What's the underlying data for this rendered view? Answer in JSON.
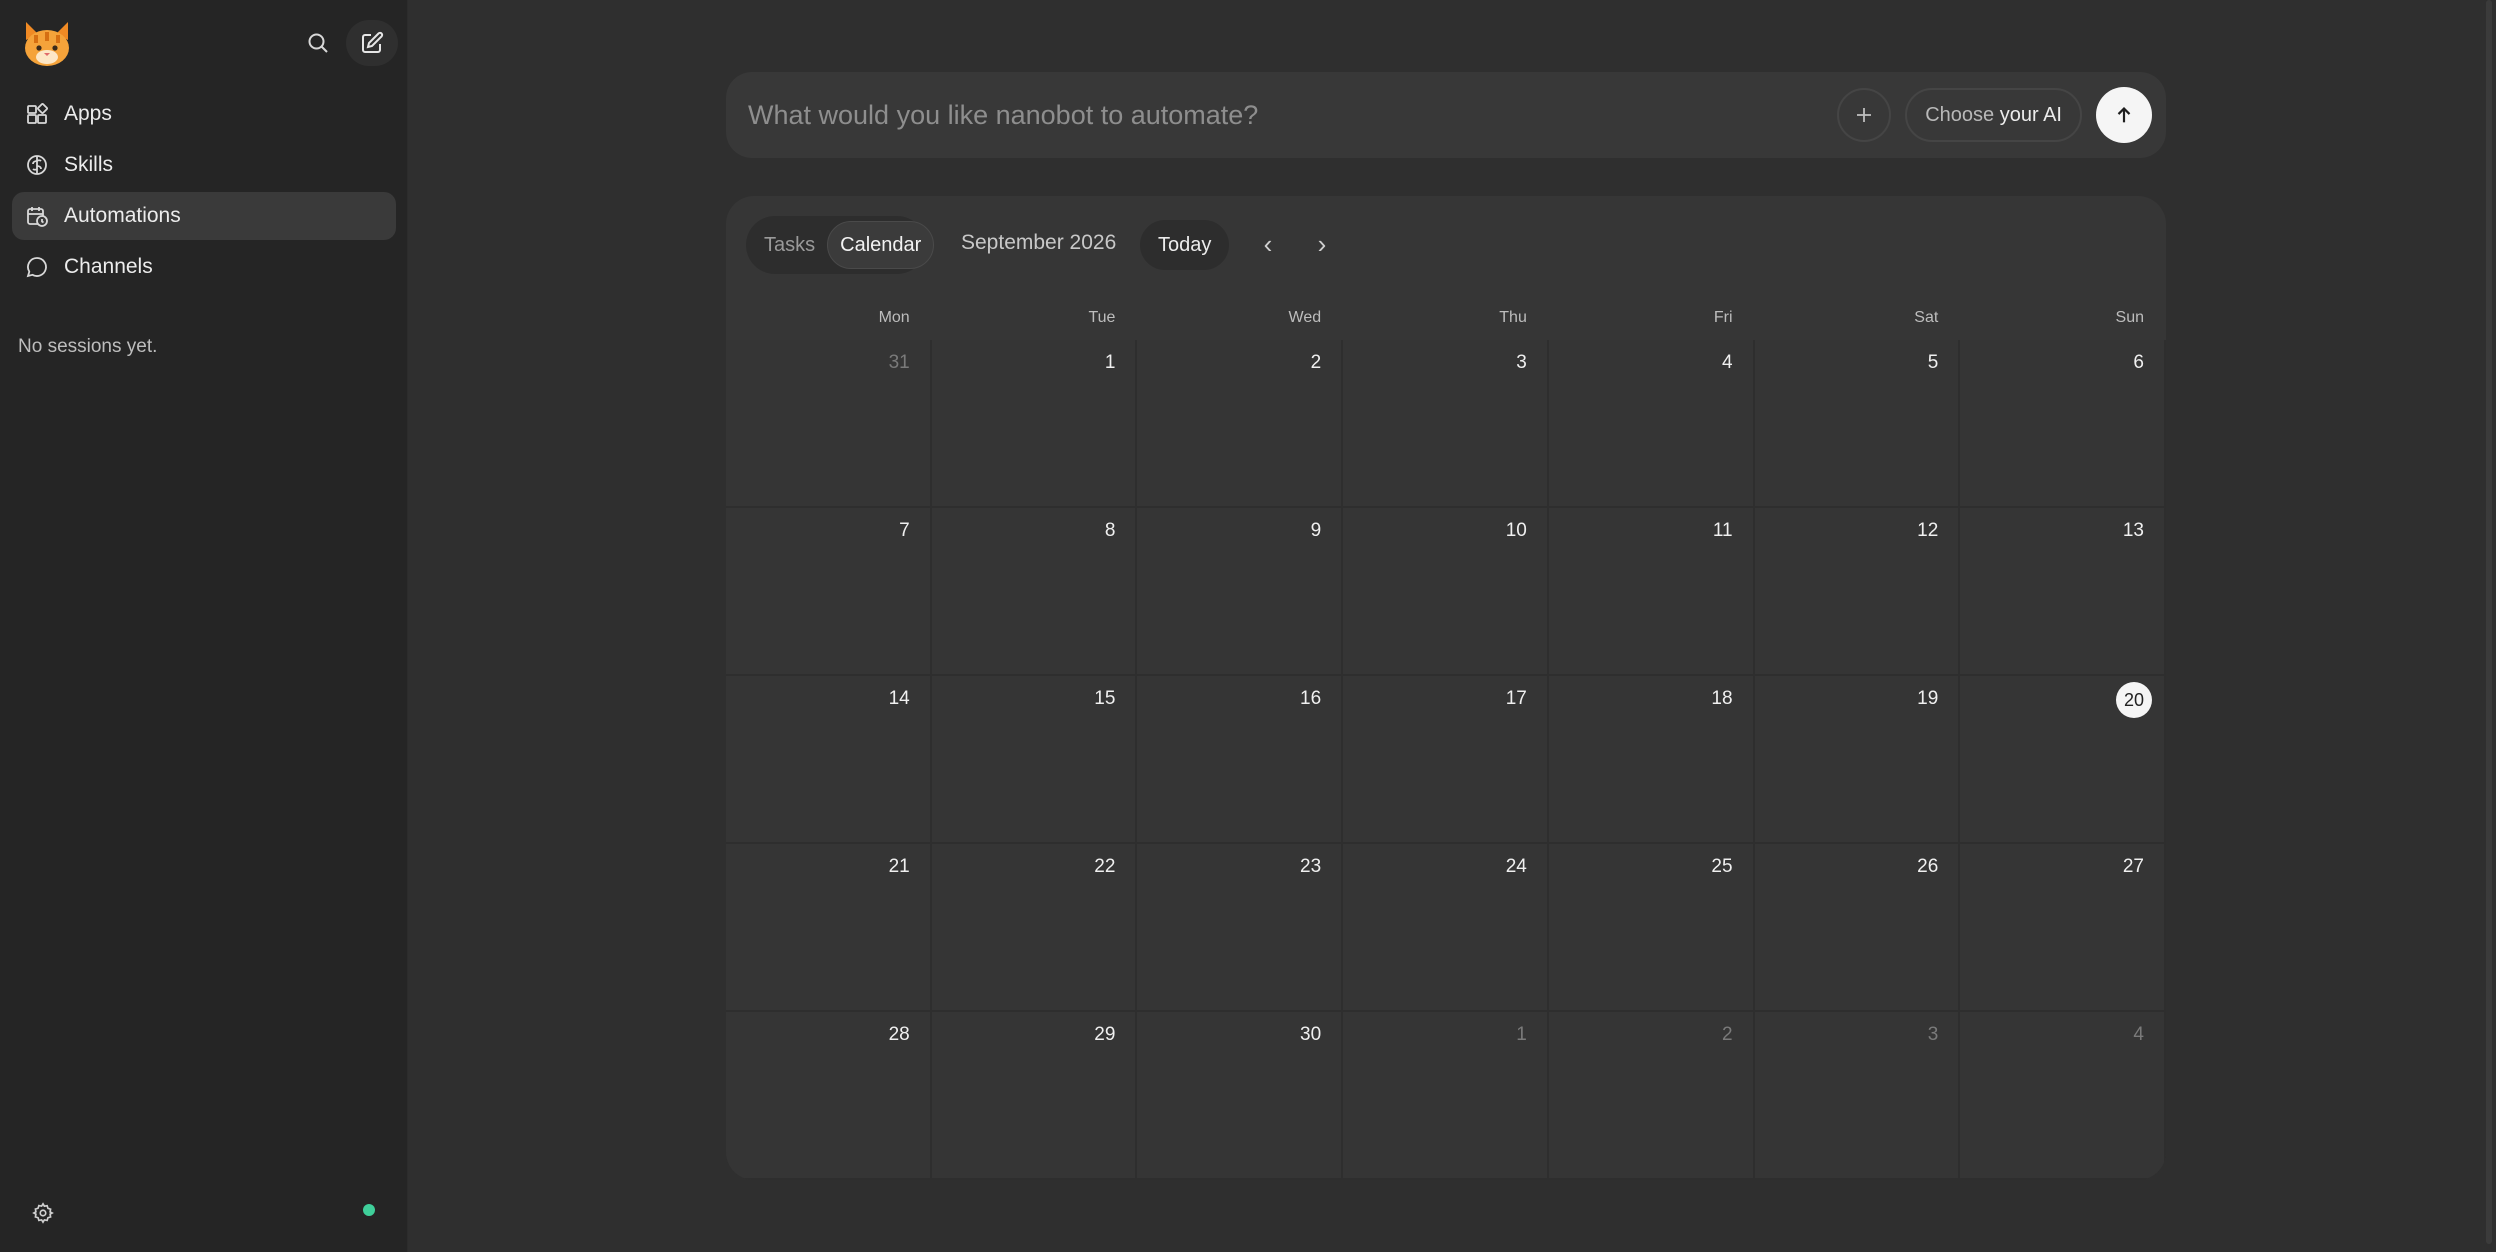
{
  "sidebar": {
    "nav": [
      {
        "label": "Apps",
        "icon": "apps-icon"
      },
      {
        "label": "Skills",
        "icon": "brain-icon"
      },
      {
        "label": "Automations",
        "icon": "calendar-clock-icon",
        "active": true
      },
      {
        "label": "Channels",
        "icon": "chat-bubble-icon"
      }
    ],
    "empty_sessions": "No sessions yet.",
    "status_color": "#3fcf9a"
  },
  "prompt": {
    "placeholder": "What would you like nanobot to automate?",
    "model_prefix": "Choose",
    "model_strong": "your AI"
  },
  "calendar": {
    "tabs": [
      "Tasks",
      "Calendar"
    ],
    "active_tab": "Calendar",
    "month_label": "September 2026",
    "today_label": "Today",
    "prev": "‹",
    "next": "›",
    "weekdays": [
      "Mon",
      "Tue",
      "Wed",
      "Thu",
      "Fri",
      "Sat",
      "Sun"
    ],
    "today": 20,
    "weeks": [
      [
        {
          "d": "31",
          "out": true
        },
        {
          "d": "1"
        },
        {
          "d": "2"
        },
        {
          "d": "3"
        },
        {
          "d": "4"
        },
        {
          "d": "5"
        },
        {
          "d": "6"
        }
      ],
      [
        {
          "d": "7"
        },
        {
          "d": "8"
        },
        {
          "d": "9"
        },
        {
          "d": "10"
        },
        {
          "d": "11"
        },
        {
          "d": "12"
        },
        {
          "d": "13"
        }
      ],
      [
        {
          "d": "14"
        },
        {
          "d": "15"
        },
        {
          "d": "16"
        },
        {
          "d": "17"
        },
        {
          "d": "18"
        },
        {
          "d": "19"
        },
        {
          "d": "20",
          "today": true
        }
      ],
      [
        {
          "d": "21"
        },
        {
          "d": "22"
        },
        {
          "d": "23"
        },
        {
          "d": "24"
        },
        {
          "d": "25"
        },
        {
          "d": "26"
        },
        {
          "d": "27"
        }
      ],
      [
        {
          "d": "28"
        },
        {
          "d": "29"
        },
        {
          "d": "30"
        },
        {
          "d": "1",
          "out": true
        },
        {
          "d": "2",
          "out": true
        },
        {
          "d": "3",
          "out": true
        },
        {
          "d": "4",
          "out": true
        }
      ]
    ]
  }
}
